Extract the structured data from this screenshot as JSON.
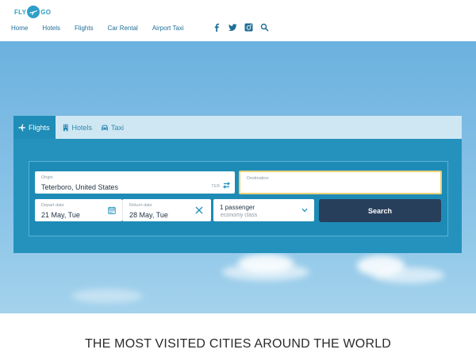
{
  "header": {
    "logo": {
      "left_text": "FLY",
      "right_text": "GO"
    },
    "nav": [
      {
        "label": "Home"
      },
      {
        "label": "Hotels"
      },
      {
        "label": "Flights"
      },
      {
        "label": "Car Rental"
      },
      {
        "label": "Airport Taxi"
      }
    ],
    "social_icons": [
      "facebook-icon",
      "twitter-icon",
      "instagram-icon",
      "search-icon"
    ],
    "colors": {
      "nav_text": "#1f6f98",
      "logo": "#2e9fc8"
    }
  },
  "search_widget": {
    "tabs": [
      {
        "label": "Flights",
        "icon": "plane-icon",
        "active": true
      },
      {
        "label": "Hotels",
        "icon": "building-icon",
        "active": false
      },
      {
        "label": "Taxi",
        "icon": "car-icon",
        "active": false
      }
    ],
    "origin": {
      "label": "Origin",
      "value": "Teterboro, United States",
      "code": "TEB"
    },
    "destination": {
      "label": "Destination",
      "value": ""
    },
    "depart": {
      "label": "Depart date",
      "value": "21 May, Tue"
    },
    "return": {
      "label": "Return date",
      "value": "28 May, Tue"
    },
    "passengers": {
      "value": "1 passenger",
      "class": "economy class"
    },
    "search_button": "Search",
    "colors": {
      "panel": "#2592bd",
      "button": "#283f5c",
      "destination_border": "#e9d27a"
    }
  },
  "section": {
    "heading": "THE MOST VISITED CITIES AROUND THE WORLD"
  }
}
